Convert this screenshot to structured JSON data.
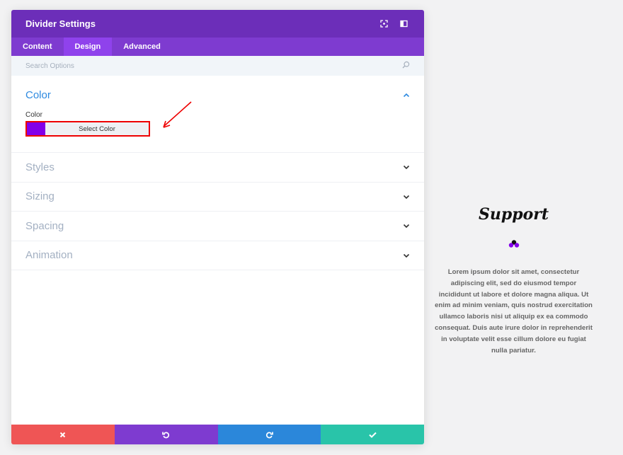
{
  "modal": {
    "title": "Divider Settings",
    "tabs": [
      {
        "label": "Content",
        "active": false
      },
      {
        "label": "Design",
        "active": true
      },
      {
        "label": "Advanced",
        "active": false
      }
    ],
    "search_placeholder": "Search Options",
    "open_group": {
      "title": "Color",
      "field_label": "Color",
      "button_label": "Select Color",
      "swatch_color": "#8300e9"
    },
    "groups": [
      {
        "title": "Styles"
      },
      {
        "title": "Sizing"
      },
      {
        "title": "Spacing"
      },
      {
        "title": "Animation"
      }
    ],
    "footer_colors": {
      "cancel": "#ef5555",
      "undo": "#7e3bd0",
      "redo": "#2b87da",
      "save": "#29c4a9"
    }
  },
  "preview": {
    "title": "Support",
    "body": "Lorem ipsum dolor sit amet, consectetur adipiscing elit, sed do eiusmod tempor incididunt ut labore et dolore magna aliqua. Ut enim ad minim veniam, quis nostrud exercitation ullamco laboris nisi ut aliquip ex ea commodo consequat. Duis aute irure dolor in reprehenderit in voluptate velit esse cillum dolore eu fugiat nulla pariatur."
  },
  "colors": {
    "header": "#6c2eb9",
    "tabs": "#7e3bd0",
    "active_tab": "#8f42ec",
    "accent_blue": "#2e8ae0",
    "highlight_red": "#e00000"
  }
}
